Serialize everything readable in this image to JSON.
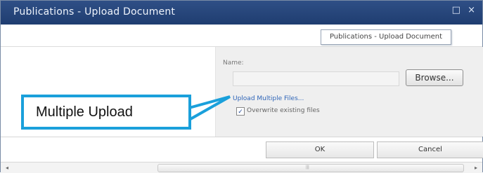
{
  "window": {
    "title": "Publications - Upload Document"
  },
  "tooltip": {
    "text": "Publications - Upload Document"
  },
  "form": {
    "name_label": "Name:",
    "browse_label": "Browse...",
    "upload_multiple_link": "Upload Multiple Files...",
    "overwrite_label": "Overwrite existing files",
    "overwrite_checked": true
  },
  "callout": {
    "text": "Multiple Upload",
    "color": "#1aa0db"
  },
  "buttons": {
    "ok_label": "OK",
    "cancel_label": "Cancel"
  },
  "icons": {
    "restore": "□",
    "close": "×",
    "check": "✓",
    "scroll_left": "◂",
    "scroll_right": "▸",
    "grip": "|||"
  }
}
